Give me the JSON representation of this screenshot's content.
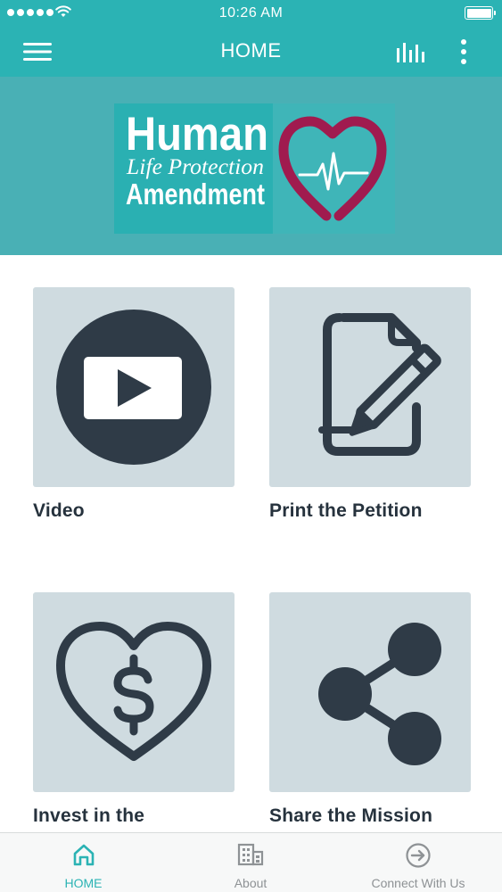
{
  "status_bar": {
    "time": "10:26 AM"
  },
  "nav": {
    "title": "HOME"
  },
  "banner": {
    "logo_line1": "Human",
    "logo_line2": "Life Protection",
    "logo_line3": "Amendment"
  },
  "tiles": [
    {
      "label": "Video",
      "icon": "play-icon"
    },
    {
      "label": "Print the Petition",
      "icon": "document-pencil-icon"
    },
    {
      "label": "Invest in the Movement",
      "icon": "heart-dollar-icon"
    },
    {
      "label": "Share the Mission",
      "icon": "share-icon"
    }
  ],
  "tabbar": {
    "active": "HOME",
    "tabs": [
      {
        "label": "HOME",
        "icon": "home-icon"
      },
      {
        "label": "About",
        "icon": "building-icon"
      },
      {
        "label": "Connect With Us",
        "icon": "arrow-circle-icon"
      }
    ]
  },
  "colors": {
    "primary": "#2bb3b4",
    "banner": "#49b0b5",
    "tile_bg": "#cfdbe0",
    "icon_dark": "#2f3b47",
    "heart": "#a01b4f"
  }
}
